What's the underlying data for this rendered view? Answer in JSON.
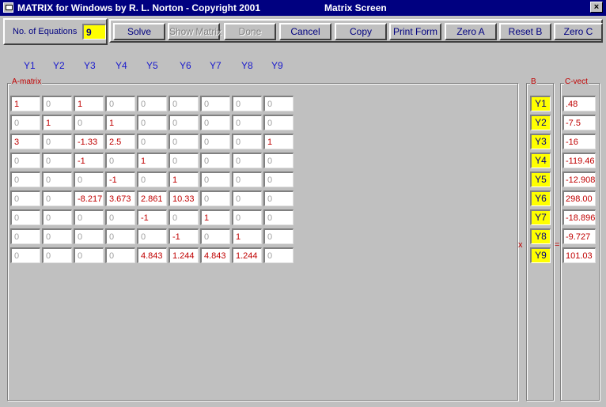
{
  "window": {
    "app_title": "MATRIX for Windows by R. L. Norton - Copyright 2001",
    "screen_title": "Matrix Screen",
    "close_label": "×"
  },
  "equations": {
    "label": "No. of Equations",
    "value": "9"
  },
  "toolbar": {
    "buttons": [
      {
        "label": "Solve",
        "enabled": true
      },
      {
        "label": "Show Matrix",
        "enabled": false
      },
      {
        "label": "Done",
        "enabled": false
      },
      {
        "label": "Cancel",
        "enabled": true
      },
      {
        "label": "Copy",
        "enabled": true
      },
      {
        "label": "Print Form",
        "enabled": true
      },
      {
        "label": "Zero A",
        "enabled": true
      },
      {
        "label": "Reset B",
        "enabled": true
      },
      {
        "label": "Zero C",
        "enabled": true
      }
    ]
  },
  "column_headers": [
    "Y1",
    "Y2",
    "Y3",
    "Y4",
    "Y5",
    "Y6",
    "Y7",
    "Y8",
    "Y9"
  ],
  "a_matrix": {
    "label": "A-matrix",
    "rows": [
      [
        "1",
        "0",
        "1",
        "0",
        "0",
        "0",
        "0",
        "0",
        "0"
      ],
      [
        "0",
        "1",
        "0",
        "1",
        "0",
        "0",
        "0",
        "0",
        "0"
      ],
      [
        "3",
        "0",
        "-1.33",
        "2.5",
        "0",
        "0",
        "0",
        "0",
        "1"
      ],
      [
        "0",
        "0",
        "-1",
        "0",
        "1",
        "0",
        "0",
        "0",
        "0"
      ],
      [
        "0",
        "0",
        "0",
        "-1",
        "0",
        "1",
        "0",
        "0",
        "0"
      ],
      [
        "0",
        "0",
        "-8.217",
        "3.673",
        "2.861",
        "10.33",
        "0",
        "0",
        "0"
      ],
      [
        "0",
        "0",
        "0",
        "0",
        "-1",
        "0",
        "1",
        "0",
        "0"
      ],
      [
        "0",
        "0",
        "0",
        "0",
        "0",
        "-1",
        "0",
        "1",
        "0"
      ],
      [
        "0",
        "0",
        "0",
        "0",
        "4.843",
        "1.244",
        "4.843",
        "1.244",
        "0"
      ]
    ]
  },
  "b_vector": {
    "label": "B",
    "items": [
      "Y1",
      "Y2",
      "Y3",
      "Y4",
      "Y5",
      "Y6",
      "Y7",
      "Y8",
      "Y9"
    ]
  },
  "c_vector": {
    "label": "C-vect",
    "items": [
      ".48",
      "-7.5",
      "-16",
      "-119.46",
      "-12.908",
      "298.00",
      "-18.896",
      "-9.727",
      "101.03"
    ]
  },
  "operators": {
    "multiply": "x",
    "equals": "="
  },
  "colors": {
    "title_bar": "#000080",
    "window_bg": "#c0c0c0",
    "value_red": "#c00000",
    "header_blue": "#1a1acd",
    "highlight_yellow": "#ffff00"
  }
}
